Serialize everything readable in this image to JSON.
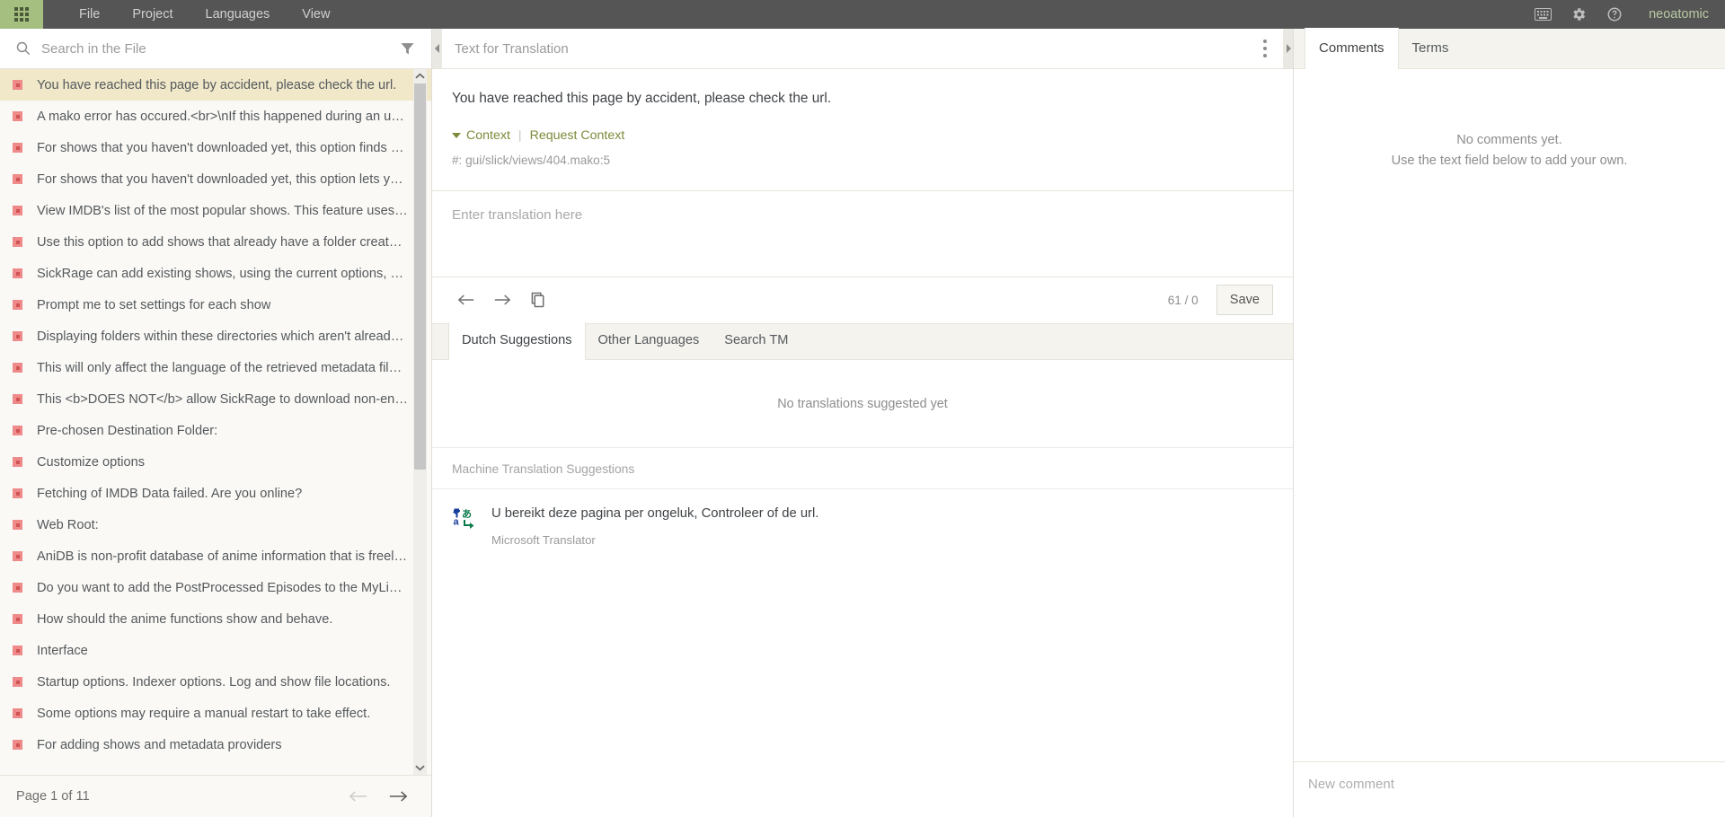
{
  "topnav": {
    "app_grid_icon": "apps-grid-icon",
    "menu": [
      {
        "label": "File"
      },
      {
        "label": "Project"
      },
      {
        "label": "Languages"
      },
      {
        "label": "View"
      }
    ],
    "icons": [
      {
        "name": "keyboard-icon"
      },
      {
        "name": "gear-icon"
      },
      {
        "name": "help-icon"
      }
    ],
    "username": "neoatomic",
    "bg_color": "#555555",
    "accent_color": "#a4bf80"
  },
  "sidebar": {
    "search": {
      "placeholder": "Search in the File",
      "value": ""
    },
    "filter_icon": "filter-funnel-icon",
    "units": [
      {
        "label": "You have reached this page by accident, please check the url.",
        "selected": true
      },
      {
        "label": "A mako error has occured.<br>\\nIf this happened during an updat...",
        "selected": false
      },
      {
        "label": "For shows that you haven't downloaded yet, this option finds a sh...",
        "selected": false
      },
      {
        "label": "For shows that you haven't downloaded yet, this option lets you c...",
        "selected": false
      },
      {
        "label": "View IMDB's list of the most popular shows. This feature uses IMD...",
        "selected": false
      },
      {
        "label": "Use this option to add shows that already have a folder created on...",
        "selected": false
      },
      {
        "label": "SickRage can add existing shows, using the current options, by usi...",
        "selected": false
      },
      {
        "label": "Prompt me to set settings for each show",
        "selected": false
      },
      {
        "label": "Displaying folders within these directories which aren't already ad...",
        "selected": false
      },
      {
        "label": "This will only affect the language of the retrieved metadata file con...",
        "selected": false
      },
      {
        "label": "This <b>DOES NOT</b> allow SickRage to download non-english T...",
        "selected": false
      },
      {
        "label": "Pre-chosen Destination Folder:",
        "selected": false
      },
      {
        "label": "Customize options",
        "selected": false
      },
      {
        "label": "Fetching of IMDB Data failed. Are you online?",
        "selected": false
      },
      {
        "label": "Web Root:",
        "selected": false
      },
      {
        "label": "AniDB is non-profit database of anime information that is freely o...",
        "selected": false
      },
      {
        "label": "Do you want to add the PostProcessed Episodes to the MyList ?",
        "selected": false
      },
      {
        "label": "How should the anime functions show and behave.",
        "selected": false
      },
      {
        "label": "Interface",
        "selected": false
      },
      {
        "label": "Startup options. Indexer options. Log and show file locations.",
        "selected": false
      },
      {
        "label": "Some options may require a manual restart to take effect.",
        "selected": false
      },
      {
        "label": "For adding shows and metadata providers",
        "selected": false
      }
    ],
    "pager": {
      "text": "Page 1 of 11",
      "prev_icon": "arrow-left-icon",
      "next_icon": "arrow-right-icon",
      "prev_enabled": false,
      "next_enabled": true
    },
    "bullet_color": "#ef8a8a",
    "selected_row_color": "#f0e8c9"
  },
  "editor": {
    "header_title": "Text for Translation",
    "collapse_left_icon": "chevron-left-icon",
    "collapse_right_icon": "chevron-right-icon",
    "kebab_icon": "more-vertical-icon",
    "source_text": "You have reached this page by accident, please check the url.",
    "context_toggle": "Context",
    "request_context": "Request Context",
    "context_detail": "#: gui/slick/views/404.mako:5",
    "context_link_color": "#7c8a3a",
    "translation": {
      "placeholder": "Enter translation here",
      "value": ""
    },
    "toolbar": {
      "prev_icon": "arrow-left-icon",
      "next_icon": "arrow-right-icon",
      "copy_icon": "copy-source-icon",
      "char_count": "61 / 0",
      "save_label": "Save"
    },
    "suggestion_tabs": [
      {
        "label": "Dutch Suggestions",
        "active": true
      },
      {
        "label": "Other Languages",
        "active": false
      },
      {
        "label": "Search TM",
        "active": false
      }
    ],
    "suggestions_empty": "No translations suggested yet",
    "mt_header": "Machine Translation Suggestions",
    "mt_items": [
      {
        "icon": "microsoft-translator-icon",
        "text": "U bereikt deze pagina per ongeluk, Controleer of de url.",
        "source": "Microsoft Translator"
      }
    ]
  },
  "rightpanel": {
    "tabs": [
      {
        "label": "Comments",
        "active": true
      },
      {
        "label": "Terms",
        "active": false
      }
    ],
    "empty_line1": "No comments yet.",
    "empty_line2": "Use the text field below to add your own.",
    "new_comment": {
      "placeholder": "New comment",
      "value": ""
    }
  }
}
